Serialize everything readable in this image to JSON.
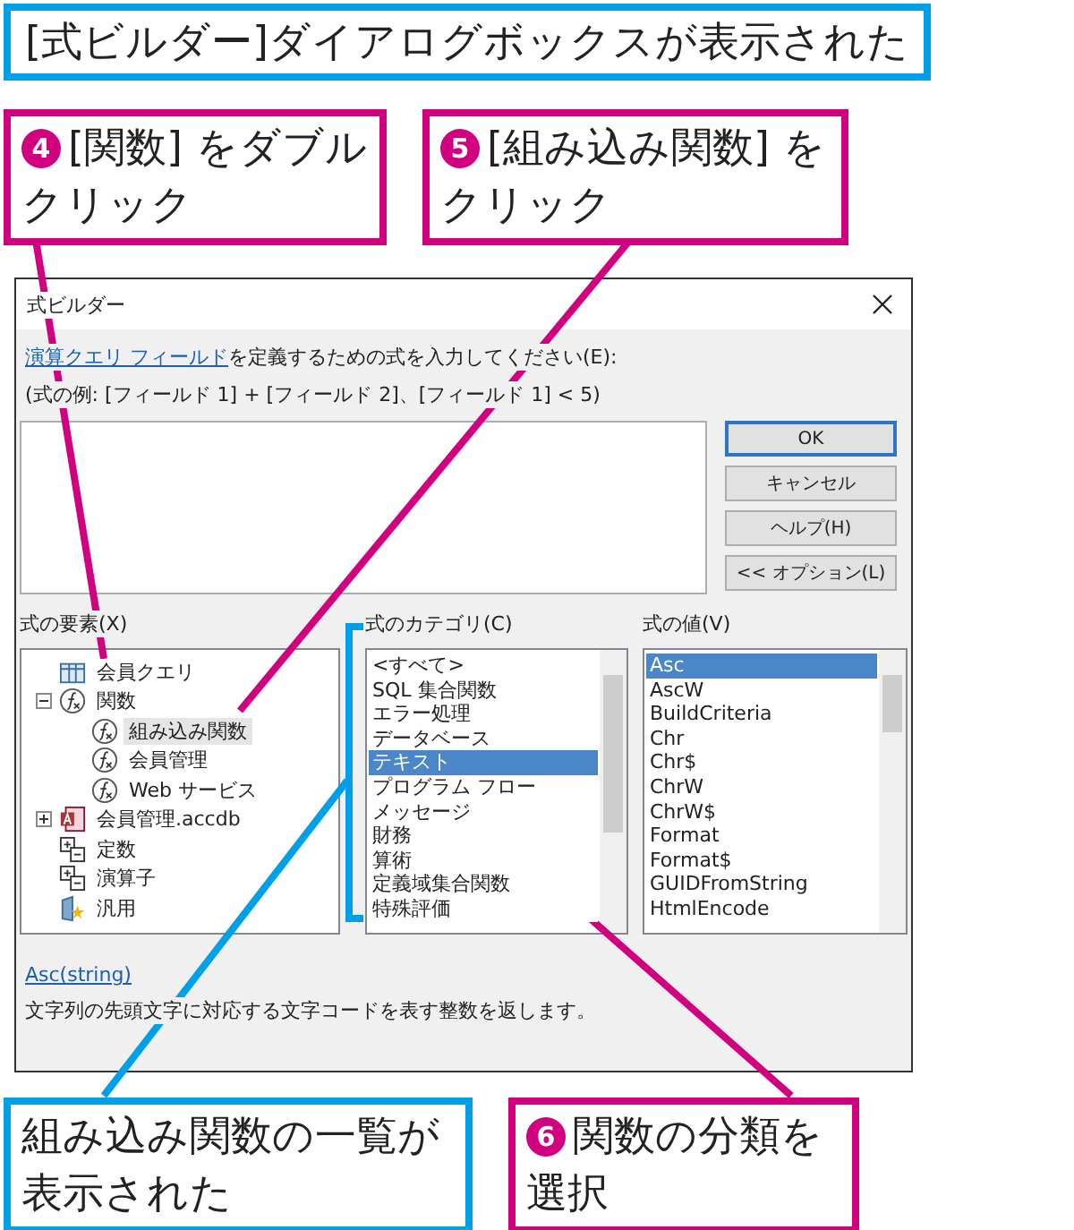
{
  "banner": "[式ビルダー]ダイアログボックスが表示された",
  "callouts_top": [
    {
      "number": "4",
      "lines": [
        "[関数] をダブル",
        "クリック"
      ]
    },
    {
      "number": "5",
      "lines": [
        "[組み込み関数] を",
        "クリック"
      ]
    }
  ],
  "dialog": {
    "title": "式ビルダー",
    "instruction": {
      "link": "演算クエリ フィールド",
      "text": "を定義するための式を入力してください(E):"
    },
    "example": "(式の例: [フィールド 1] + [フィールド 2]、[フィールド 1] < 5)",
    "buttons": [
      {
        "label": "OK",
        "default": true
      },
      {
        "label": "キャンセル",
        "default": false
      },
      {
        "label": "ヘルプ(H)",
        "default": false
      },
      {
        "label": "<< オプション(L)",
        "default": false
      }
    ],
    "elements": {
      "label": "式の要素(X)",
      "tree": [
        {
          "kind": "query",
          "label": "会員クエリ",
          "selected": false
        },
        {
          "kind": "function",
          "label": "関数",
          "selected": false,
          "expanded": true,
          "children": [
            {
              "kind": "function",
              "label": "組み込み関数",
              "selected": true
            },
            {
              "kind": "function",
              "label": "会員管理",
              "selected": false
            },
            {
              "kind": "function",
              "label": "Web サービス",
              "selected": false
            }
          ]
        },
        {
          "kind": "database",
          "label": "会員管理.accdb",
          "selected": false,
          "expanded": false
        },
        {
          "kind": "constants",
          "label": "定数",
          "selected": false
        },
        {
          "kind": "operators",
          "label": "演算子",
          "selected": false
        },
        {
          "kind": "common",
          "label": "汎用",
          "selected": false
        }
      ]
    },
    "categories": {
      "label": "式のカテゴリ(C)",
      "items": [
        {
          "label": "<すべて>",
          "selected": false
        },
        {
          "label": "SQL 集合関数",
          "selected": false
        },
        {
          "label": "エラー処理",
          "selected": false
        },
        {
          "label": "データベース",
          "selected": false
        },
        {
          "label": "テキスト",
          "selected": true
        },
        {
          "label": "プログラム フロー",
          "selected": false
        },
        {
          "label": "メッセージ",
          "selected": false
        },
        {
          "label": "財務",
          "selected": false
        },
        {
          "label": "算術",
          "selected": false
        },
        {
          "label": "定義域集合関数",
          "selected": false
        },
        {
          "label": "特殊評価",
          "selected": false
        }
      ]
    },
    "values": {
      "label": "式の値(V)",
      "items": [
        {
          "label": "Asc",
          "selected": true
        },
        {
          "label": "AscW",
          "selected": false
        },
        {
          "label": "BuildCriteria",
          "selected": false
        },
        {
          "label": "Chr",
          "selected": false
        },
        {
          "label": "Chr$",
          "selected": false
        },
        {
          "label": "ChrW",
          "selected": false
        },
        {
          "label": "ChrW$",
          "selected": false
        },
        {
          "label": "Format",
          "selected": false
        },
        {
          "label": "Format$",
          "selected": false
        },
        {
          "label": "GUIDFromString",
          "selected": false
        },
        {
          "label": "HtmlEncode",
          "selected": false
        }
      ]
    },
    "syntax_link": "Asc(string)",
    "description": "文字列の先頭文字に対応する文字コードを表す整数を返します。"
  },
  "callouts_bottom": [
    {
      "lines": [
        "組み込み関数の一覧が",
        "表示された"
      ],
      "color": "#00a0e9"
    },
    {
      "number": "6",
      "lines": [
        "関数の分類を",
        "選択"
      ],
      "color": "#d0007f"
    }
  ]
}
